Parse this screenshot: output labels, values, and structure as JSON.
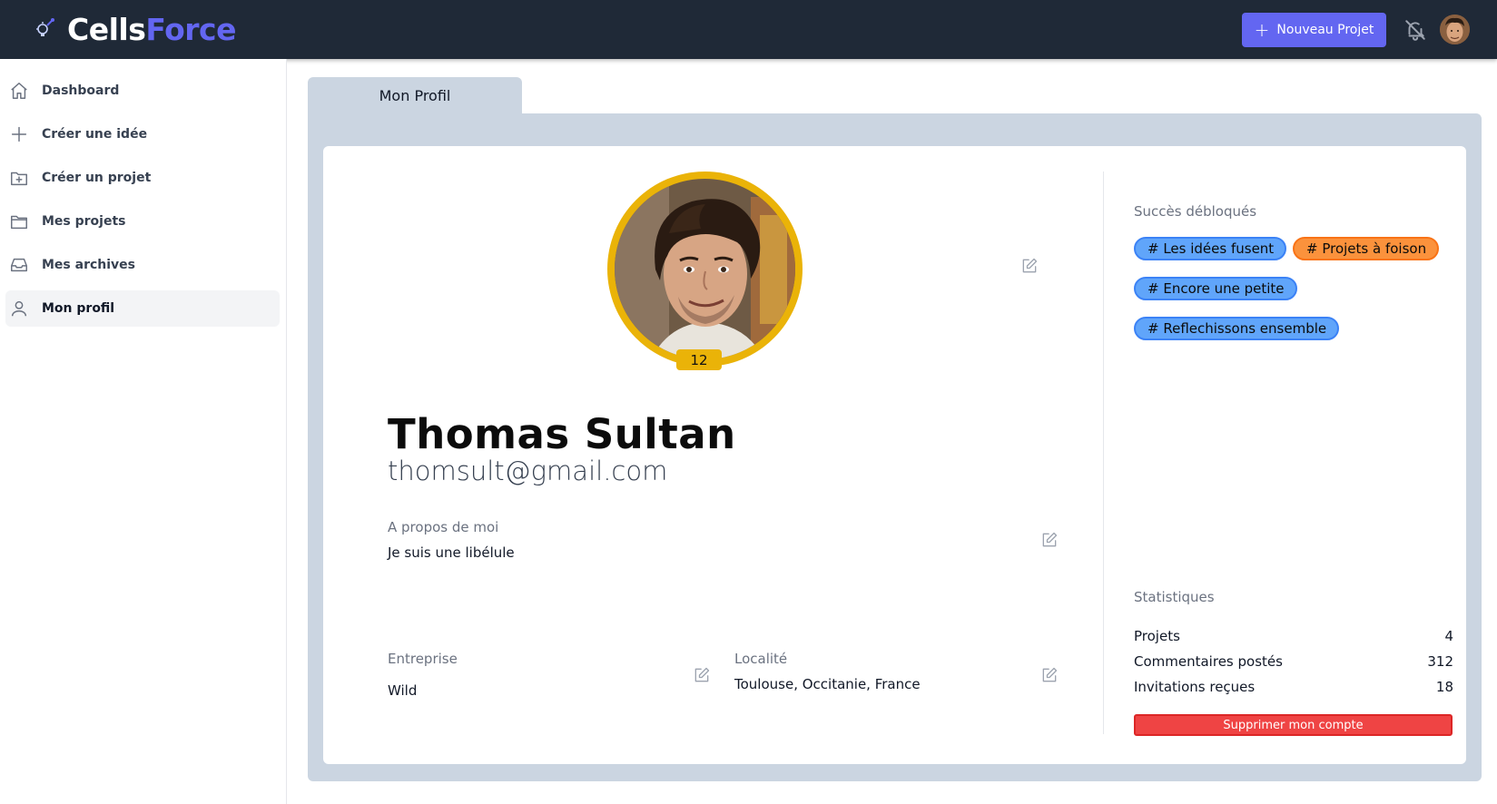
{
  "header": {
    "logo_part1": "Cells",
    "logo_part2": "Force",
    "new_project_label": "Nouveau Projet",
    "accent_color": "#6366f1",
    "background_color": "#1f2937"
  },
  "sidebar": {
    "items": [
      {
        "label": "Dashboard",
        "icon": "home-icon",
        "active": false
      },
      {
        "label": "Créer une idée",
        "icon": "plus-icon",
        "active": false
      },
      {
        "label": "Créer un projet",
        "icon": "folder-plus-icon",
        "active": false
      },
      {
        "label": "Mes projets",
        "icon": "folder-icon",
        "active": false
      },
      {
        "label": "Mes archives",
        "icon": "inbox-icon",
        "active": false
      },
      {
        "label": "Mon profil",
        "icon": "user-icon",
        "active": true
      }
    ]
  },
  "tab": {
    "label": "Mon Profil"
  },
  "profile": {
    "level": "12",
    "name": "Thomas Sultan",
    "email": "thomsult@gmail.com",
    "about_label": "A propos de moi",
    "about_value": "Je suis une libélule",
    "company_label": "Entreprise",
    "company_value": "Wild",
    "location_label": "Localité",
    "location_value": "Toulouse, Occitanie, France"
  },
  "achievements": {
    "title": "Succès débloqués",
    "tags": [
      {
        "label": "# Les idées fusent",
        "color": "blue"
      },
      {
        "label": "# Projets à foison",
        "color": "orange"
      },
      {
        "label": "# Encore une petite",
        "color": "blue"
      },
      {
        "label": "# Reflechissons ensemble",
        "color": "blue"
      }
    ]
  },
  "statistics": {
    "title": "Statistiques",
    "rows": [
      {
        "label": "Projets",
        "value": "4"
      },
      {
        "label": "Commentaires postés",
        "value": "312"
      },
      {
        "label": "Invitations reçues",
        "value": "18"
      }
    ]
  },
  "delete_account_label": "Supprimer mon compte"
}
